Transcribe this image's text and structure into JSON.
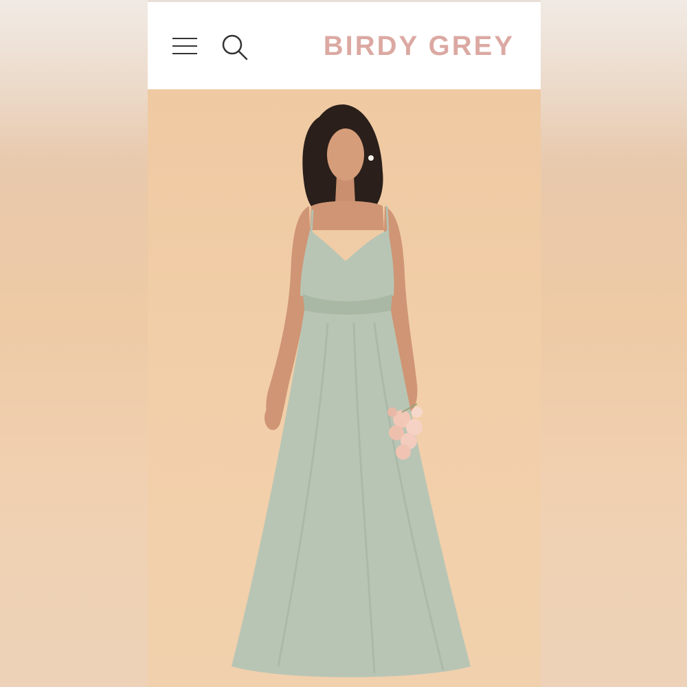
{
  "header": {
    "menu_icon": "hamburger-menu-icon",
    "search_icon": "search-icon",
    "brand": "BIRDY GREY"
  },
  "colors": {
    "brand": "#dba9a2",
    "dress": "#b8c5b4",
    "background": "#f1cfa6"
  }
}
